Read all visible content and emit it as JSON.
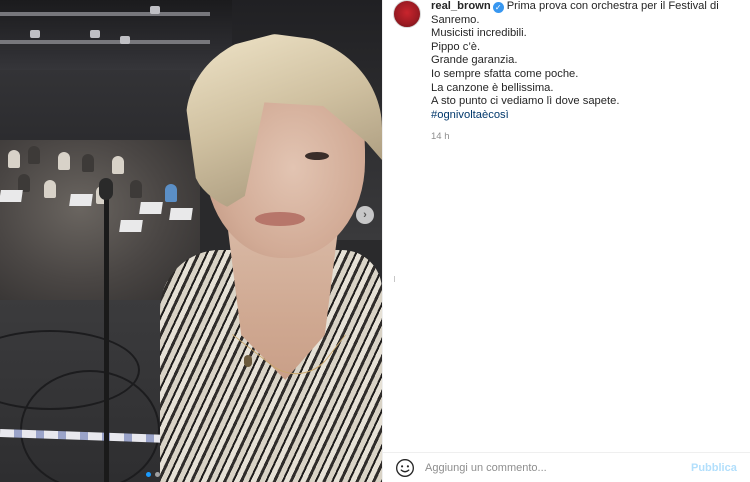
{
  "post": {
    "author": "real_brown",
    "caption_lines": [
      "Prima prova con orchestra per il Festival di",
      "Sanremo.",
      "Musicisti incredibili.",
      "Pippo c’è.",
      "Grande garanzia.",
      "Io sempre sfatta come poche.",
      "La canzone è bellissima.",
      "A sto punto ci vediamo lì dove sapete."
    ],
    "hashtag": "#ognivoltaècosì",
    "timestamp": "14 h"
  },
  "comment": {
    "placeholder": "Aggiungi un commento...",
    "publish_label": "Pubblica"
  },
  "icons": {
    "verified": "verified-badge-icon",
    "emoji": "emoji-icon",
    "next": "chevron-right-icon"
  },
  "colors": {
    "verified": "#3897f0",
    "hashtag": "#00376b",
    "publish_disabled": "#b2dffc",
    "muted": "#8e8e8e"
  },
  "carousel": {
    "current": 1,
    "total": 2
  }
}
